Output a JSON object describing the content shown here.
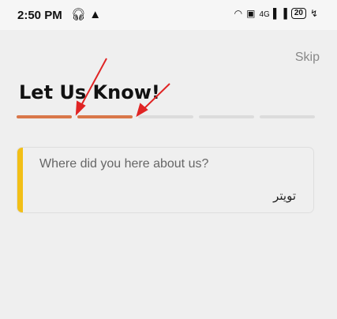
{
  "status_bar": {
    "time": "2:50 PM",
    "left_icons": [
      "headphones-icon",
      "warning-icon"
    ],
    "right_icons": [
      "wifi-icon",
      "volte-icon",
      "signal-4g-icon",
      "signal-icon"
    ],
    "network_label": "4G",
    "battery": "20",
    "charging_icon": "charging-icon"
  },
  "header": {
    "skip_label": "Skip",
    "title": "Let Us Know!"
  },
  "progress": {
    "total_steps": 5,
    "completed_steps": 2,
    "active_color": "#d9774a",
    "inactive_color": "#dcdcdc"
  },
  "card": {
    "question": "Where did you here about us?",
    "answer": "تويتر",
    "accent_color": "#f2bf16"
  },
  "annotations": {
    "arrow_color": "#e02424",
    "count": 2
  }
}
